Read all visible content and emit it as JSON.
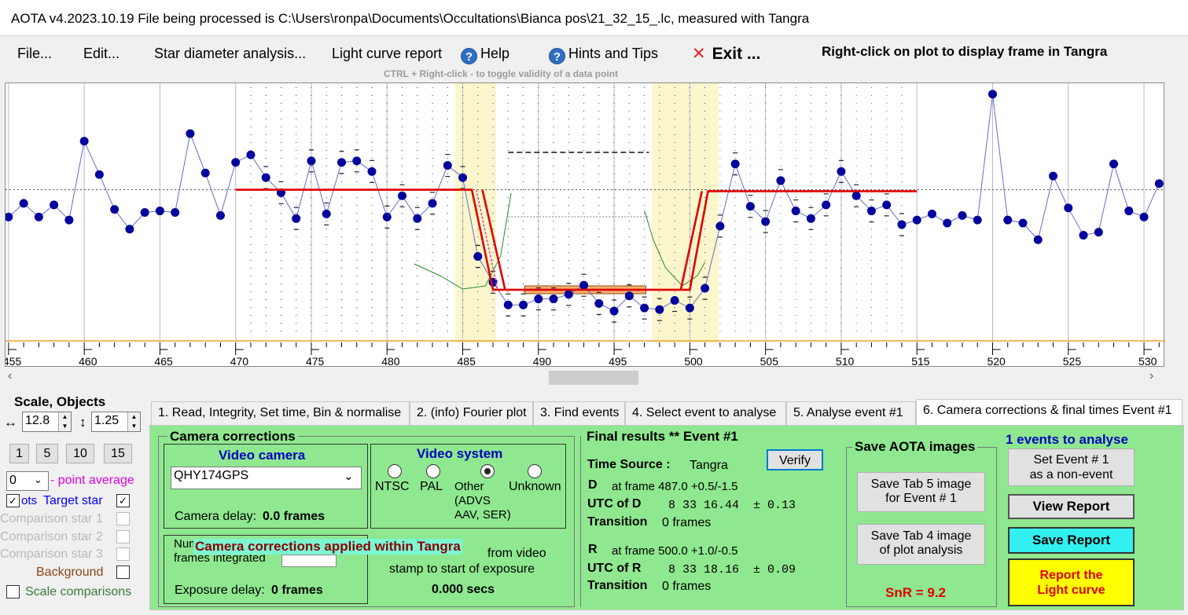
{
  "window": {
    "title": "AOTA v4.2023.10.19    File being processed is C:\\Users\\ronpa\\Documents\\Occultations\\Bianca pos\\21_32_15_.lc, measured with Tangra"
  },
  "menu": {
    "file": "File...",
    "edit": "Edit...",
    "star_diameter": "Star diameter analysis...",
    "light_curve_report": "Light curve report",
    "help": "Help",
    "hints": "Hints and Tips",
    "exit": "Exit ...",
    "right_click_hint": "Right-click on plot to display frame in Tangra",
    "ctrl_hint": "CTRL + Right-click  -  to toggle validity of a data point"
  },
  "chart_data": {
    "type": "line",
    "x_ticks": [
      455,
      460,
      465,
      470,
      475,
      480,
      485,
      490,
      495,
      500,
      505,
      510,
      515,
      520,
      525,
      530
    ],
    "xlim": [
      454.8,
      531.4
    ],
    "y_scale": "relative (no axis labels)",
    "series": [
      {
        "x": [
          455,
          456,
          457,
          458,
          459,
          460,
          461,
          462,
          463,
          464,
          465,
          466,
          467,
          468,
          469,
          470,
          471,
          472,
          473,
          474,
          475,
          476,
          477,
          478,
          479,
          480,
          481,
          482,
          483,
          484,
          485,
          486,
          487,
          488,
          489,
          490,
          491,
          492,
          493,
          494,
          495,
          496,
          497,
          498,
          499,
          500,
          501,
          502,
          503,
          504,
          505,
          506,
          507,
          508,
          509,
          510,
          511,
          512,
          513,
          514,
          515,
          516,
          517,
          518,
          519,
          520,
          521,
          522,
          523,
          524,
          525,
          526,
          527,
          528,
          529,
          530,
          531
        ],
        "values": [
          0.62,
          0.71,
          0.62,
          0.7,
          0.6,
          1.12,
          0.9,
          0.67,
          0.54,
          0.65,
          0.66,
          0.65,
          1.17,
          0.91,
          0.63,
          0.98,
          1.03,
          0.88,
          0.78,
          0.61,
          0.99,
          0.64,
          0.98,
          0.99,
          0.92,
          0.62,
          0.76,
          0.61,
          0.71,
          0.96,
          0.88,
          0.36,
          0.19,
          0.04,
          0.04,
          0.08,
          0.08,
          0.11,
          0.17,
          0.05,
          0.0,
          0.1,
          0.02,
          0.01,
          0.07,
          0.02,
          0.15,
          0.56,
          0.97,
          0.69,
          0.59,
          0.86,
          0.66,
          0.61,
          0.7,
          0.92,
          0.76,
          0.66,
          0.7,
          0.57,
          0.6,
          0.64,
          0.58,
          0.63,
          0.6,
          1.43,
          0.6,
          0.58,
          0.47,
          0.89,
          0.68,
          0.5,
          0.52,
          0.97,
          0.66,
          0.62,
          0.84
        ]
      }
    ],
    "baseline_level": 0.8,
    "event_bottom_level": 0.14,
    "event_D_frame": 487.0,
    "event_R_frame": 500.0
  },
  "left": {
    "scale_objects": "Scale,  Objects",
    "scale_value": "12.8",
    "objects_value": "1.25",
    "buttons": [
      "1",
      "5",
      "10",
      "15"
    ],
    "point_avg_value": "0",
    "point_avg_label": "- point average",
    "dots_label": "ots",
    "target_star": "Target star",
    "comp1": "Comparison star 1",
    "comp2": "Comparison star 2",
    "comp3": "Comparison star 3",
    "background": "Background",
    "scale_comparisons": "Scale comparisons"
  },
  "tabs": [
    "1.  Read, Integrity, Set time, Bin & normalise",
    "2. (info)  Fourier plot",
    "3. Find events",
    "4. Select event to analyse",
    "5. Analyse event #1",
    "6. Camera corrections & final times Event #1"
  ],
  "camera": {
    "title": "Camera corrections",
    "video_camera_label": "Video camera",
    "camera_value": "QHY174GPS",
    "camera_delay_label": "Camera delay: ",
    "camera_delay_value": "0.0 frames",
    "video_system_label": "Video system",
    "ntsc": "NTSC",
    "pal": "PAL",
    "other": "Other\n(ADVS\nAAV, SER)",
    "unknown": "Unknown",
    "num_frames": "Num\nframes integrated",
    "applied_banner": "Camera corrections applied within Tangra",
    "exposure_delay_label": "Exposure delay: ",
    "exposure_delay_value": "0 frames",
    "from_video": "from video",
    "stamp_start": "stamp to start of exposure",
    "secs_value": "0.000 secs"
  },
  "final": {
    "title": "Final results  **  Event #1",
    "time_source_label": "Time Source :",
    "time_source_value": "Tangra",
    "verify": "Verify",
    "d_label": "D",
    "d_frame": "at frame 487.0  +0.5/-1.5",
    "utc_d_label": "UTC of D",
    "utc_d_value": " 8 33 16.44  ± 0.13",
    "transition_label": "Transition",
    "transition_d": "0 frames",
    "r_label": "R",
    "r_frame": "at frame 500.0  +1.0/-0.5",
    "utc_r_label": "UTC of R",
    "utc_r_value": " 8 33 18.16  ± 0.09",
    "transition_r": "0 frames"
  },
  "save": {
    "title": "Save AOTA images",
    "tab5": "Save Tab 5 image\nfor Event # 1",
    "tab4": "Save Tab 4 image\nof plot analysis",
    "snr": "SnR = 9.2"
  },
  "actions": {
    "events_to_analyse": "1  events to analyse",
    "set_non_event": "Set Event # 1\nas a non-event",
    "view_report": "View Report",
    "save_report": "Save Report",
    "report_lc": "Report the\nLight curve"
  },
  "colors": {
    "panel_green": "#8fe88f",
    "event_shade": "#fbf6cc",
    "fit_red": "#e00000",
    "data_blue": "#00009c",
    "save_report_bg": "#33f0f0",
    "report_bg": "#ffff00",
    "banner_fg": "#8b0000"
  }
}
